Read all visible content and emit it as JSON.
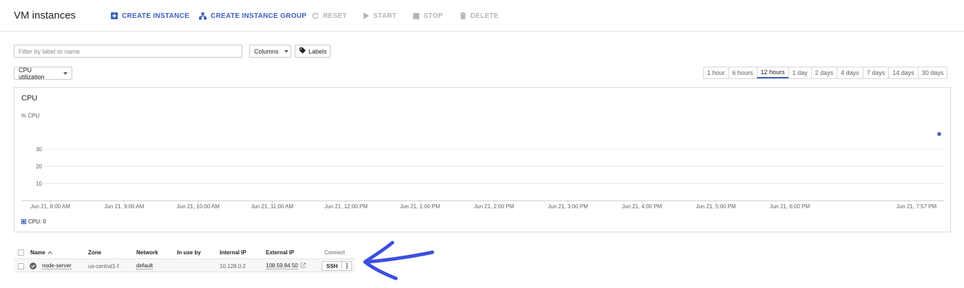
{
  "header": {
    "title": "VM instances",
    "actions": {
      "create_instance": "CREATE INSTANCE",
      "create_group": "CREATE INSTANCE GROUP",
      "reset": "RESET",
      "start": "START",
      "stop": "STOP",
      "delete": "DELETE"
    }
  },
  "filter": {
    "placeholder": "Filter by label or name",
    "columns_label": "Columns",
    "labels_label": "Labels"
  },
  "metric": {
    "selected": "CPU utilization"
  },
  "time_ranges": [
    "1 hour",
    "6 hours",
    "12 hours",
    "1 day",
    "2 days",
    "4 days",
    "7 days",
    "14 days",
    "30 days"
  ],
  "time_range_selected": "12 hours",
  "chart": {
    "title": "CPU",
    "ylabel": "% CPU",
    "legend": "CPU: 0",
    "yticks": [
      "30",
      "20",
      "10"
    ],
    "xticks": [
      "Jun 21, 8:00 AM",
      "Jun 21, 9:00 AM",
      "Jun 21, 10:00 AM",
      "Jun 21, 11:00 AM",
      "Jun 21, 12:00 PM",
      "Jun 21, 1:00 PM",
      "Jun 21, 2:00 PM",
      "Jun 21, 3:00 PM",
      "Jun 21, 4:00 PM",
      "Jun 21, 5:00 PM",
      "Jun 21, 6:00 PM",
      "Jun 21, 7:57 PM"
    ],
    "series_color": "#3b5db8"
  },
  "table": {
    "headers": {
      "name": "Name",
      "zone": "Zone",
      "network": "Network",
      "in_use_by": "In use by",
      "internal_ip": "Internal IP",
      "external_ip": "External IP",
      "connect": "Connect"
    },
    "rows": [
      {
        "name": "node-server",
        "zone": "us-central1-f",
        "network": "default",
        "in_use_by": "",
        "internal_ip": "10.128.0.2",
        "external_ip": "108.59.84.50",
        "connect": "SSH",
        "status": "running"
      }
    ]
  },
  "colors": {
    "accent": "#3b5db8",
    "annotation_arrow": "#3d4fe0"
  }
}
